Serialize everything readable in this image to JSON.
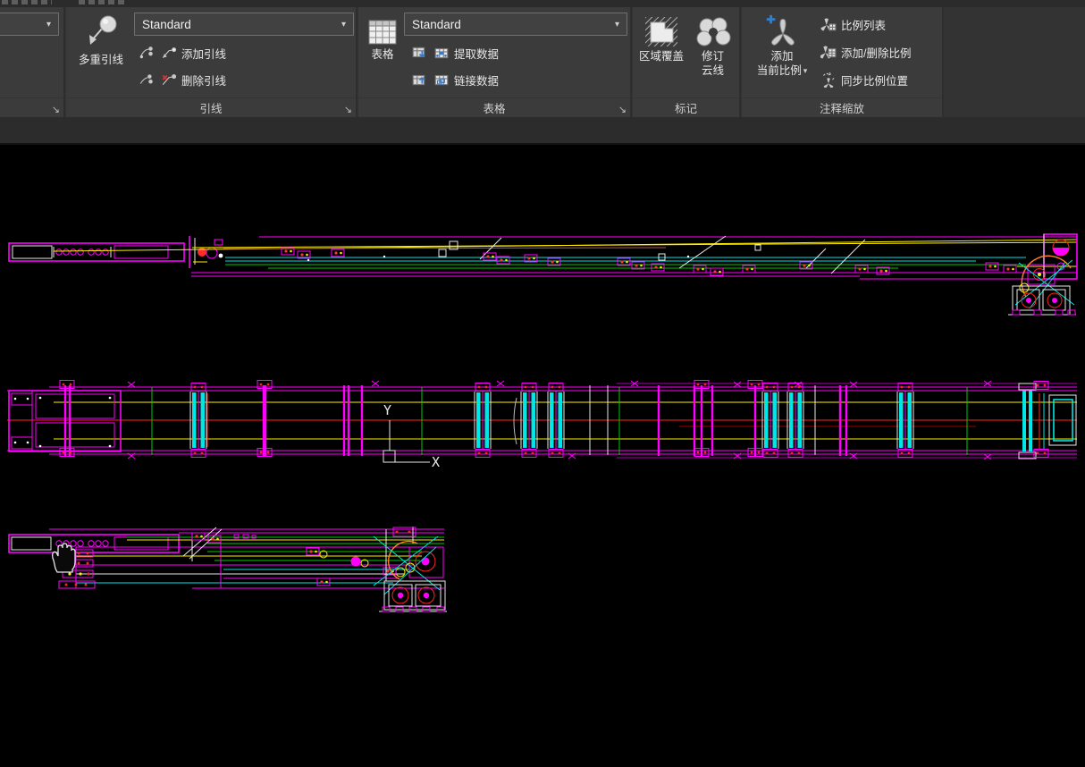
{
  "icons": {
    "combo_caret": "▾",
    "dialog_launcher": "↘",
    "split_caret": "▾"
  },
  "ribbon": {
    "leaders_panel": {
      "title": "引线",
      "multileader_label": "多重引线",
      "style_value": "Standard",
      "add_leader_label": "添加引线",
      "remove_leader_label": "删除引线"
    },
    "tables_panel": {
      "title": "表格",
      "table_label": "表格",
      "style_value": "Standard",
      "extract_data_label": "提取数据",
      "link_data_label": "链接数据"
    },
    "markup_panel": {
      "title": "标记",
      "wipeout_label": "区域覆盖",
      "revcloud_line1": "修订",
      "revcloud_line2": "云线"
    },
    "annotation_scaling_panel": {
      "title": "注释缩放",
      "add_current_scale_line1": "添加",
      "add_current_scale_line2": "当前比例",
      "scale_list_label": "比例列表",
      "add_delete_scales_label": "添加/删除比例",
      "sync_scale_positions_label": "同步比例位置"
    }
  },
  "canvas": {
    "ucs_x_label": "X",
    "ucs_y_label": "Y",
    "background": "#000000",
    "layer_palette": {
      "magenta": "#ff00ff",
      "yellow": "#ffee00",
      "cyan": "#00e5e5",
      "green": "#00cc00",
      "red": "#ff2222",
      "white": "#e8e8e8",
      "orange": "#ff7f2a",
      "purple": "#b000b0"
    }
  },
  "theme": {
    "ribbon_panel_bg": "#3b3b3b",
    "ribbon_void_bg": "#333333",
    "belt_bg": "#2c2c2c",
    "text_color": "#e8e8e8",
    "accent_blue": "#3a78c2"
  }
}
